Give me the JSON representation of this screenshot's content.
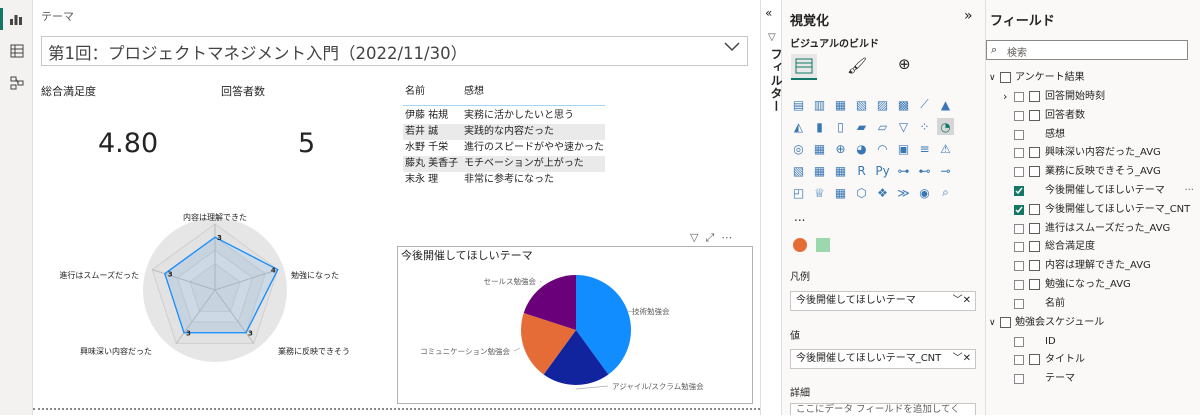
{
  "slicer": {
    "label": "テーマ",
    "value": "第1回：プロジェクトマネジメント入門（2022/11/30）"
  },
  "kpis": [
    {
      "label": "総合満足度",
      "value": "4.80"
    },
    {
      "label": "回答者数",
      "value": "5"
    }
  ],
  "table": {
    "headers": [
      "名前",
      "感想"
    ],
    "rows": [
      [
        "伊藤 祐規",
        "実務に活かしたいと思う"
      ],
      [
        "若井 誠",
        "実践的な内容だった"
      ],
      [
        "水野 千栄",
        "進行のスピードがやや速かった"
      ],
      [
        "藤丸 美香子",
        "モチベーションが上がった"
      ],
      [
        "末永 理",
        "非常に参考になった"
      ]
    ]
  },
  "radar": {
    "axes": [
      {
        "label": "内容は理解できた",
        "value": 3
      },
      {
        "label": "勉強になった",
        "value": 4
      },
      {
        "label": "業務に反映できそう",
        "value": 3
      },
      {
        "label": "興味深い内容だった",
        "value": 3
      },
      {
        "label": "進行はスムーズだった",
        "value": 3
      }
    ]
  },
  "chart_data": {
    "type": "pie",
    "title": "今後開催してほしいテーマ",
    "categories": [
      "技術勉強会",
      "アジャイル/スクラム勉強会",
      "コミュニケーション勉強会",
      "セールス勉強会"
    ],
    "values": [
      2,
      1,
      1,
      1
    ],
    "colors": [
      "#118dff",
      "#12239e",
      "#e66c37",
      "#6b007b"
    ]
  },
  "filters_tab": "フィルター",
  "viz": {
    "title": "視覚化",
    "build": "ビジュアルのビルド",
    "more": "...",
    "legend_label": "凡例",
    "legend_value": "今後開催してほしいテーマ",
    "values_label": "値",
    "values_value": "今後開催してほしいテーマ_CNT",
    "details_label": "詳細",
    "details_placeholder": "ここにデータ フィールドを追加してく"
  },
  "fields": {
    "title": "フィールド",
    "search_placeholder": "検索",
    "tables": [
      {
        "name": "アンケート結果",
        "items": [
          {
            "label": "回答開始時刻",
            "checked": false,
            "type": "date"
          },
          {
            "label": "回答者数",
            "checked": false,
            "type": "calc"
          },
          {
            "label": "感想",
            "checked": false,
            "type": "text"
          },
          {
            "label": "興味深い内容だった_AVG",
            "checked": false,
            "type": "calc"
          },
          {
            "label": "業務に反映できそう_AVG",
            "checked": false,
            "type": "calc"
          },
          {
            "label": "今後開催してほしいテーマ",
            "checked": true,
            "type": "text"
          },
          {
            "label": "今後開催してほしいテーマ_CNT",
            "checked": true,
            "type": "calc"
          },
          {
            "label": "進行はスムーズだった_AVG",
            "checked": false,
            "type": "calc"
          },
          {
            "label": "総合満足度",
            "checked": false,
            "type": "calc"
          },
          {
            "label": "内容は理解できた_AVG",
            "checked": false,
            "type": "calc"
          },
          {
            "label": "勉強になった_AVG",
            "checked": false,
            "type": "calc"
          },
          {
            "label": "名前",
            "checked": false,
            "type": "text"
          }
        ]
      },
      {
        "name": "勉強会スケジュール",
        "items": [
          {
            "label": "ID",
            "checked": false,
            "type": "text"
          },
          {
            "label": "タイトル",
            "checked": false,
            "type": "calc"
          },
          {
            "label": "テーマ",
            "checked": false,
            "type": "text"
          }
        ]
      }
    ],
    "ellipsis": "···"
  }
}
